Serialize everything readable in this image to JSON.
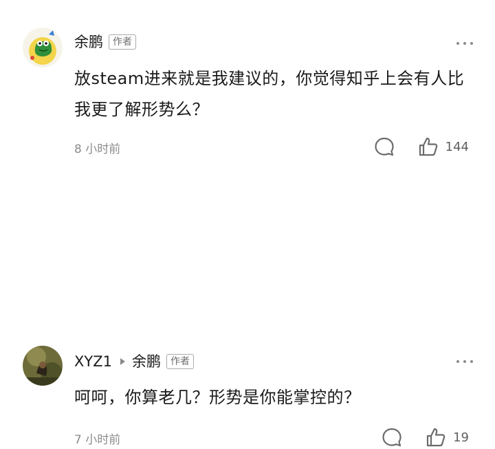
{
  "comments": [
    {
      "author": "余鹏",
      "author_badge": "作者",
      "content": "放steam进来就是我建议的，你觉得知乎上会有人比我更了解形势么？",
      "time": "8 小时前",
      "like_count": "144",
      "avatar_icon": "frog-avatar-icon",
      "more_icon": "more-dots-icon",
      "reply_icon": "comment-bubble-icon",
      "like_icon": "thumbs-up-icon"
    },
    {
      "author": "XYZ1",
      "reply_to": "余鹏",
      "reply_to_badge": "作者",
      "content": "呵呵，你算老几？形势是你能掌控的？",
      "time": "7 小时前",
      "like_count": "19",
      "avatar_icon": "photo-avatar-icon",
      "more_icon": "more-dots-icon",
      "reply_icon": "comment-bubble-icon",
      "like_icon": "thumbs-up-icon"
    }
  ],
  "colors": {
    "text": "#1b1b1b",
    "muted": "#8c8c8c",
    "icon": "#6b6b6b",
    "badge_border": "#a8a8a8"
  }
}
